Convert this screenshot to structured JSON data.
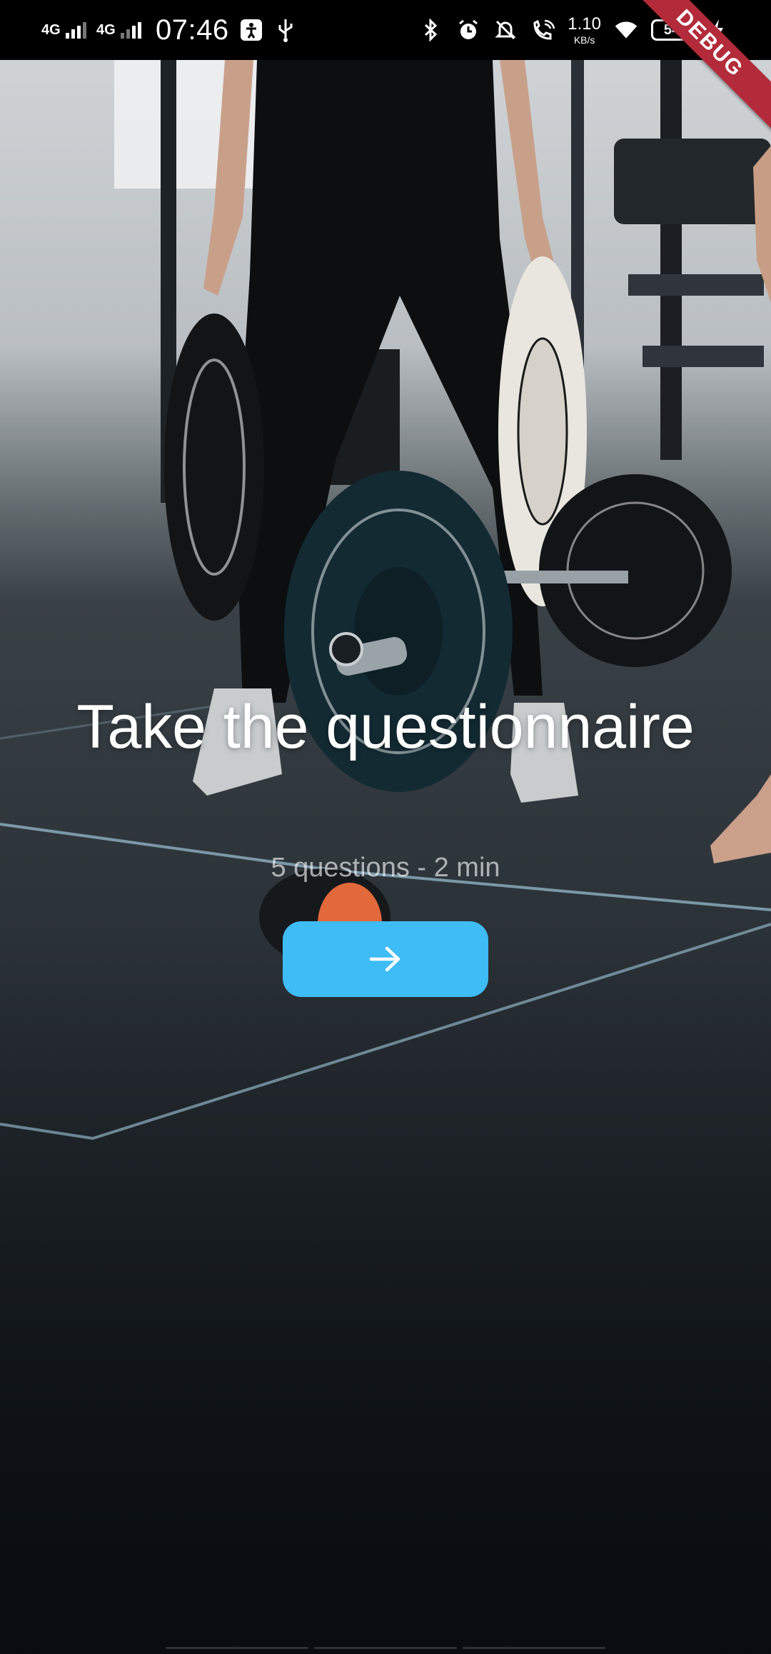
{
  "status_bar": {
    "network_1": "4G",
    "network_2": "4G",
    "time": "07:46",
    "speed_value": "1.10",
    "speed_unit": "KB/s",
    "battery_level": "54",
    "icons": [
      "signal-icon",
      "signal-icon",
      "accessibility-icon",
      "usb-icon",
      "bluetooth-icon",
      "alarm-icon",
      "mute-icon",
      "wifi-calling-icon",
      "wifi-icon",
      "battery-icon",
      "charging-icon"
    ]
  },
  "debug_banner": "DEBUG",
  "main": {
    "title": "Take the questionnaire",
    "subtitle": "5 questions - 2 min",
    "next_button_icon": "arrow-right-icon"
  },
  "colors": {
    "accent": "#3ebcf6",
    "debug": "#b32b3a",
    "status_bar_bg": "#000000"
  }
}
